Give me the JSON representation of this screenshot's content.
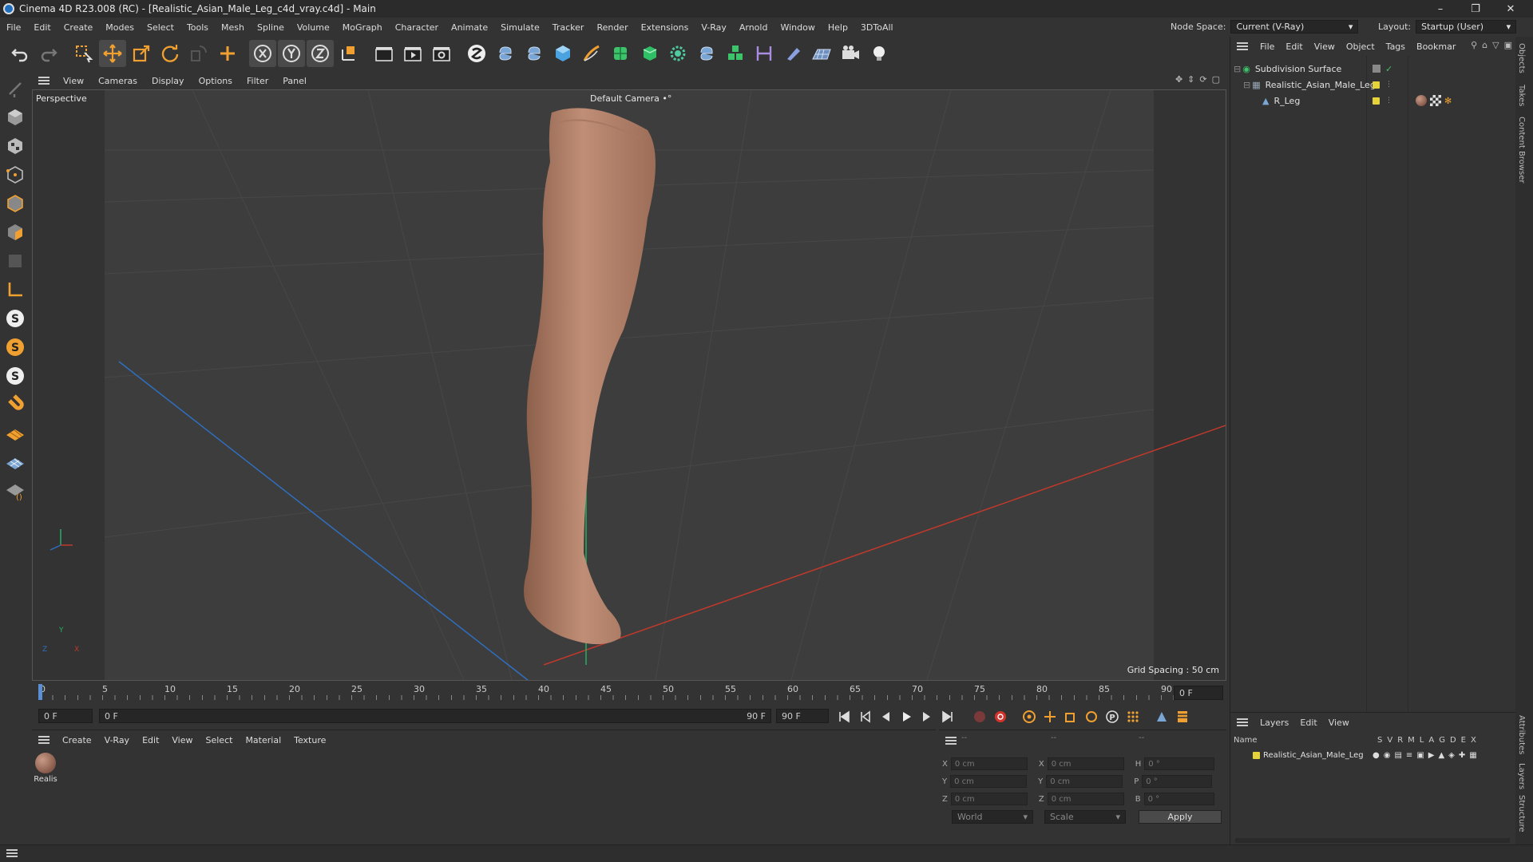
{
  "window": {
    "title": "Cinema 4D R23.008 (RC) - [Realistic_Asian_Male_Leg_c4d_vray.c4d] - Main",
    "minimize": "–",
    "maximize": "❐",
    "close": "✕"
  },
  "menu": [
    "File",
    "Edit",
    "Create",
    "Modes",
    "Select",
    "Tools",
    "Mesh",
    "Spline",
    "Volume",
    "MoGraph",
    "Character",
    "Animate",
    "Simulate",
    "Tracker",
    "Render",
    "Extensions",
    "V-Ray",
    "Arnold",
    "Window",
    "Help",
    "3DToAll"
  ],
  "node_space": {
    "label": "Node Space:",
    "value": "Current (V-Ray)"
  },
  "layout": {
    "label": "Layout:",
    "value": "Startup (User)"
  },
  "viewport": {
    "menu": [
      "View",
      "Cameras",
      "Display",
      "Options",
      "Filter",
      "Panel"
    ],
    "view_name": "Perspective",
    "camera": "Default Camera",
    "camera_icon": "•°",
    "grid_spacing": "Grid Spacing : 50 cm",
    "axis_y": "Y",
    "axis_z": "Z",
    "axis_x": "X"
  },
  "timeline": {
    "ticks": [
      "0",
      "5",
      "10",
      "15",
      "20",
      "25",
      "30",
      "35",
      "40",
      "45",
      "50",
      "55",
      "60",
      "65",
      "70",
      "75",
      "80",
      "85",
      "90"
    ],
    "current_frame_display": "0 F",
    "start_field": "0 F",
    "range_start": "0 F",
    "range_end": "90 F",
    "end_field": "90 F"
  },
  "material_manager": {
    "menu": [
      "Create",
      "V-Ray",
      "Edit",
      "View",
      "Select",
      "Material",
      "Texture"
    ],
    "materials": [
      {
        "name": "Realis"
      }
    ]
  },
  "coordinates": {
    "header_left": "--",
    "header_mid": "--",
    "header_right": "--",
    "rows": [
      {
        "l1": "X",
        "v1": "0 cm",
        "l2": "X",
        "v2": "0 cm",
        "l3": "H",
        "v3": "0 °"
      },
      {
        "l1": "Y",
        "v1": "0 cm",
        "l2": "Y",
        "v2": "0 cm",
        "l3": "P",
        "v3": "0 °"
      },
      {
        "l1": "Z",
        "v1": "0 cm",
        "l2": "Z",
        "v2": "0 cm",
        "l3": "B",
        "v3": "0 °"
      }
    ],
    "mode": "World",
    "transform": "Scale",
    "apply": "Apply"
  },
  "object_manager": {
    "menu": [
      "File",
      "Edit",
      "View",
      "Object",
      "Tags",
      "Bookmar"
    ],
    "objects": [
      {
        "name": "Subdivision Surface"
      },
      {
        "name": "Realistic_Asian_Male_Leg"
      },
      {
        "name": "R_Leg"
      }
    ]
  },
  "layer_manager": {
    "menu": [
      "Layers",
      "Edit",
      "View"
    ],
    "name_header": "Name",
    "columns": [
      "S",
      "V",
      "R",
      "M",
      "L",
      "A",
      "G",
      "D",
      "E",
      "X"
    ],
    "layers": [
      {
        "name": "Realistic_Asian_Male_Leg"
      }
    ]
  },
  "side_tabs": [
    "Objects",
    "Takes",
    "Content Browser",
    "Attributes",
    "Layers",
    "Structure"
  ],
  "colors": {
    "accent_orange": "#f0a030",
    "axis_x": "#c0392b",
    "axis_y": "#27ae60",
    "axis_z": "#2f6fbf",
    "layer_yellow": "#e6d23a"
  }
}
